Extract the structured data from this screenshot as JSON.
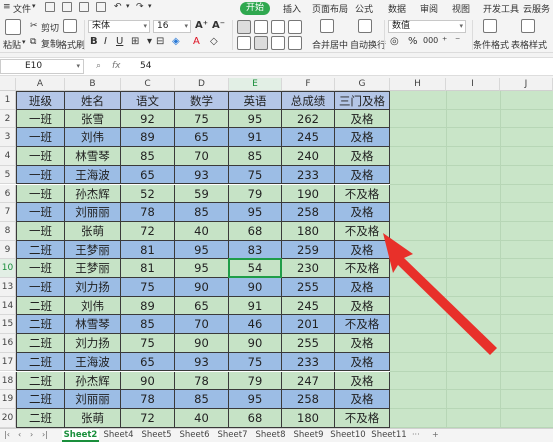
{
  "menubar": {
    "file_label": "文件",
    "active_tab": "开始",
    "tabs": [
      "插入",
      "页面布局",
      "公式",
      "数据",
      "审阅",
      "视图",
      "开发工具",
      "云服务"
    ]
  },
  "ribbon": {
    "paste_label": "粘贴",
    "cut_label": "剪切",
    "copy_label": "复制",
    "format_painter_label": "格式刷",
    "font_name": "宋体",
    "font_size": "16",
    "merge_label": "合并居中",
    "wrap_label": "自动换行",
    "number_format": "数值",
    "conditional_format_label": "条件格式",
    "table_style_label": "表格样式"
  },
  "formula_bar": {
    "cell_ref": "E10",
    "fx_label": "fx",
    "value": "54"
  },
  "grid": {
    "columns": [
      "A",
      "B",
      "C",
      "D",
      "E",
      "F",
      "G",
      "H",
      "I",
      "J"
    ],
    "row_numbers": [
      "1",
      "2",
      "3",
      "4",
      "5",
      "6",
      "7",
      "8",
      "9",
      "10",
      "13",
      "14",
      "15",
      "16",
      "17",
      "18",
      "19",
      "20"
    ],
    "selected_column": "E",
    "selected_row": "10"
  },
  "table": {
    "headers": [
      "班级",
      "姓名",
      "语文",
      "数学",
      "英语",
      "总成绩",
      "三门及格"
    ],
    "rows": [
      [
        "一班",
        "张雪",
        "92",
        "75",
        "95",
        "262",
        "及格"
      ],
      [
        "一班",
        "刘伟",
        "89",
        "65",
        "91",
        "245",
        "及格"
      ],
      [
        "一班",
        "林雪琴",
        "85",
        "70",
        "85",
        "240",
        "及格"
      ],
      [
        "一班",
        "王海波",
        "65",
        "93",
        "75",
        "233",
        "及格"
      ],
      [
        "一班",
        "孙杰辉",
        "52",
        "59",
        "79",
        "190",
        "不及格"
      ],
      [
        "一班",
        "刘丽丽",
        "78",
        "85",
        "95",
        "258",
        "及格"
      ],
      [
        "一班",
        "张萌",
        "72",
        "40",
        "68",
        "180",
        "不及格"
      ],
      [
        "二班",
        "王梦丽",
        "81",
        "95",
        "83",
        "259",
        "及格"
      ],
      [
        "一班",
        "王梦丽",
        "81",
        "95",
        "54",
        "230",
        "不及格"
      ],
      [
        "一班",
        "刘力扬",
        "75",
        "90",
        "90",
        "255",
        "及格"
      ],
      [
        "二班",
        "刘伟",
        "89",
        "65",
        "91",
        "245",
        "及格"
      ],
      [
        "二班",
        "林雪琴",
        "85",
        "70",
        "46",
        "201",
        "不及格"
      ],
      [
        "二班",
        "刘力扬",
        "75",
        "90",
        "90",
        "255",
        "及格"
      ],
      [
        "二班",
        "王海波",
        "65",
        "93",
        "75",
        "233",
        "及格"
      ],
      [
        "二班",
        "孙杰辉",
        "90",
        "78",
        "79",
        "247",
        "及格"
      ],
      [
        "二班",
        "刘丽丽",
        "78",
        "85",
        "95",
        "258",
        "及格"
      ],
      [
        "二班",
        "张萌",
        "72",
        "40",
        "68",
        "180",
        "不及格"
      ]
    ],
    "colors": {
      "header_bg": "#b4c6e7",
      "green_bg": "#c6e3c6",
      "blue_bg": "#9cbde5",
      "border": "#3a3a3a"
    }
  },
  "sheet_tabs": {
    "tabs": [
      "Sheet2",
      "Sheet4",
      "Sheet5",
      "Sheet6",
      "Sheet7",
      "Sheet8",
      "Sheet9",
      "Sheet10",
      "Sheet11"
    ],
    "active": "Sheet2"
  },
  "annotation": {
    "arrow_color": "#e8302a"
  }
}
